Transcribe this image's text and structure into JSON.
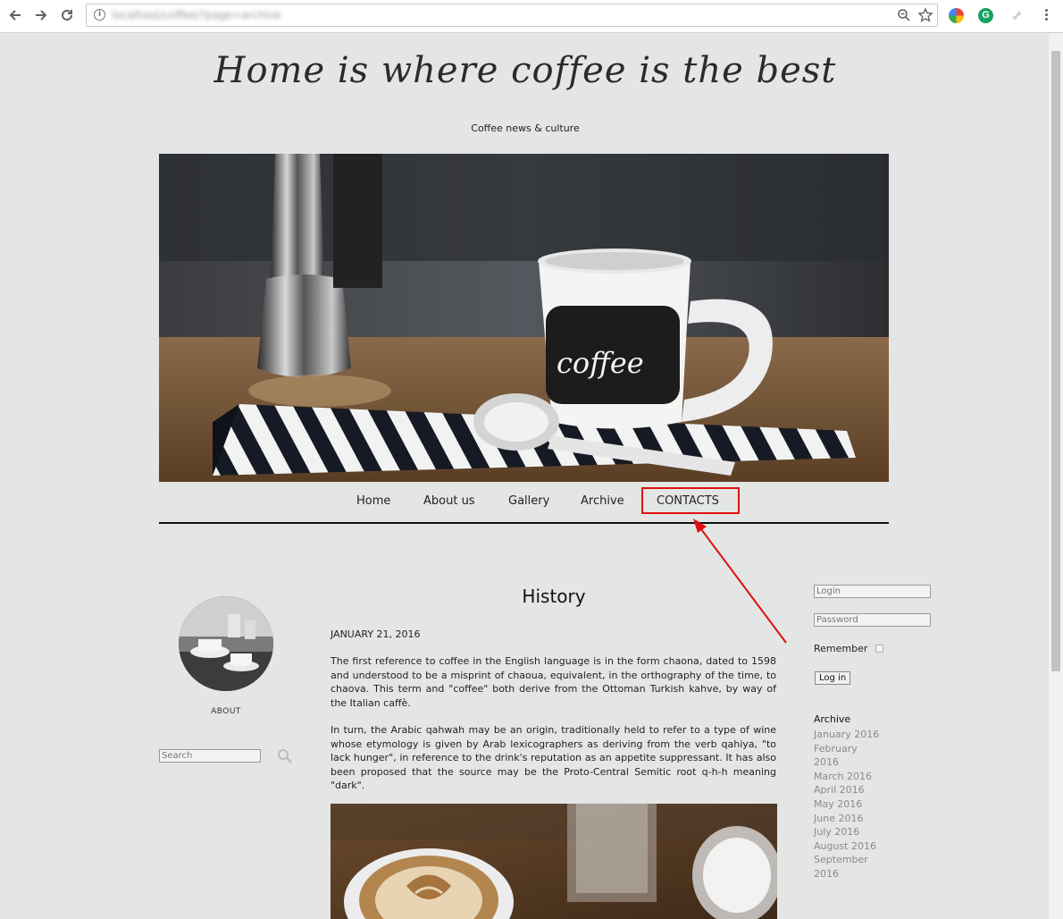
{
  "browser": {
    "url": "localhost/coffee/?page=archive",
    "icons": [
      "back-icon",
      "forward-icon",
      "reload-icon",
      "info-icon",
      "zoom-icon",
      "star-icon",
      "menu-icon"
    ],
    "extension_g_label": "G"
  },
  "site": {
    "title": "Home is where coffee is the best",
    "tagline": "Coffee news & culture"
  },
  "nav": {
    "items": [
      {
        "label": "Home"
      },
      {
        "label": "About us"
      },
      {
        "label": "Gallery"
      },
      {
        "label": "Archive"
      },
      {
        "label": "CONTACTS"
      }
    ]
  },
  "annotation": {
    "highlight_color": "#e01010",
    "target": "CONTACTS"
  },
  "left_sidebar": {
    "about_label": "ABOUT",
    "search_placeholder": "Search"
  },
  "article": {
    "title": "History",
    "date": "JANUARY 21, 2016",
    "paragraphs": [
      "The first reference to coffee in the English language is in the form chaona, dated to 1598 and understood to be a misprint of chaoua, equivalent, in the orthography of the time, to chaova. This term and \"coffee\" both derive from the Ottoman Turkish kahve, by way of the Italian caffè.",
      "In turn, the Arabic qahwah may be an origin, traditionally held to refer to a type of wine whose etymology is given by Arab lexicographers as deriving from the verb qahiya, \"to lack hunger\", in reference to the drink's reputation as an appetite suppressant. It has also been proposed that the source may be the Proto-Central Semitic root q-h-h meaning \"dark\"."
    ]
  },
  "right_sidebar": {
    "login_placeholder": "Login",
    "password_placeholder": "Password",
    "remember_label": "Remember",
    "login_button": "Log in",
    "archive_heading": "Archive",
    "archive_items": [
      "January 2016",
      "February 2016",
      "March 2016",
      "April 2016",
      "May 2016",
      "June 2016",
      "July 2016",
      "August 2016",
      "September 2016"
    ]
  },
  "colors": {
    "page_bg": "#e4e5e5",
    "accent_red": "#e01010",
    "archive_link": "#8a8a8a"
  }
}
